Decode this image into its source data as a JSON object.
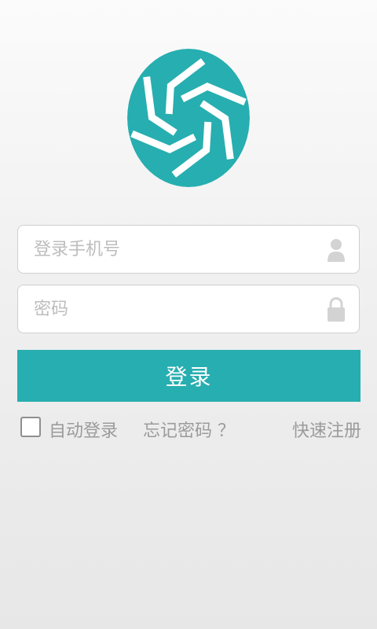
{
  "logo": {
    "icon": "aperture-logo",
    "color": "#27aeb0"
  },
  "form": {
    "phone": {
      "placeholder": "登录手机号",
      "value": "",
      "icon": "user-icon"
    },
    "password": {
      "placeholder": "密码",
      "value": "",
      "icon": "lock-icon"
    },
    "login_button": "登录",
    "login_button_color": "#27aeb0"
  },
  "options": {
    "auto_login_label": "自动登录",
    "auto_login_checked": false,
    "forgot_password": "忘记密码 ？",
    "quick_register": "快速注册"
  }
}
